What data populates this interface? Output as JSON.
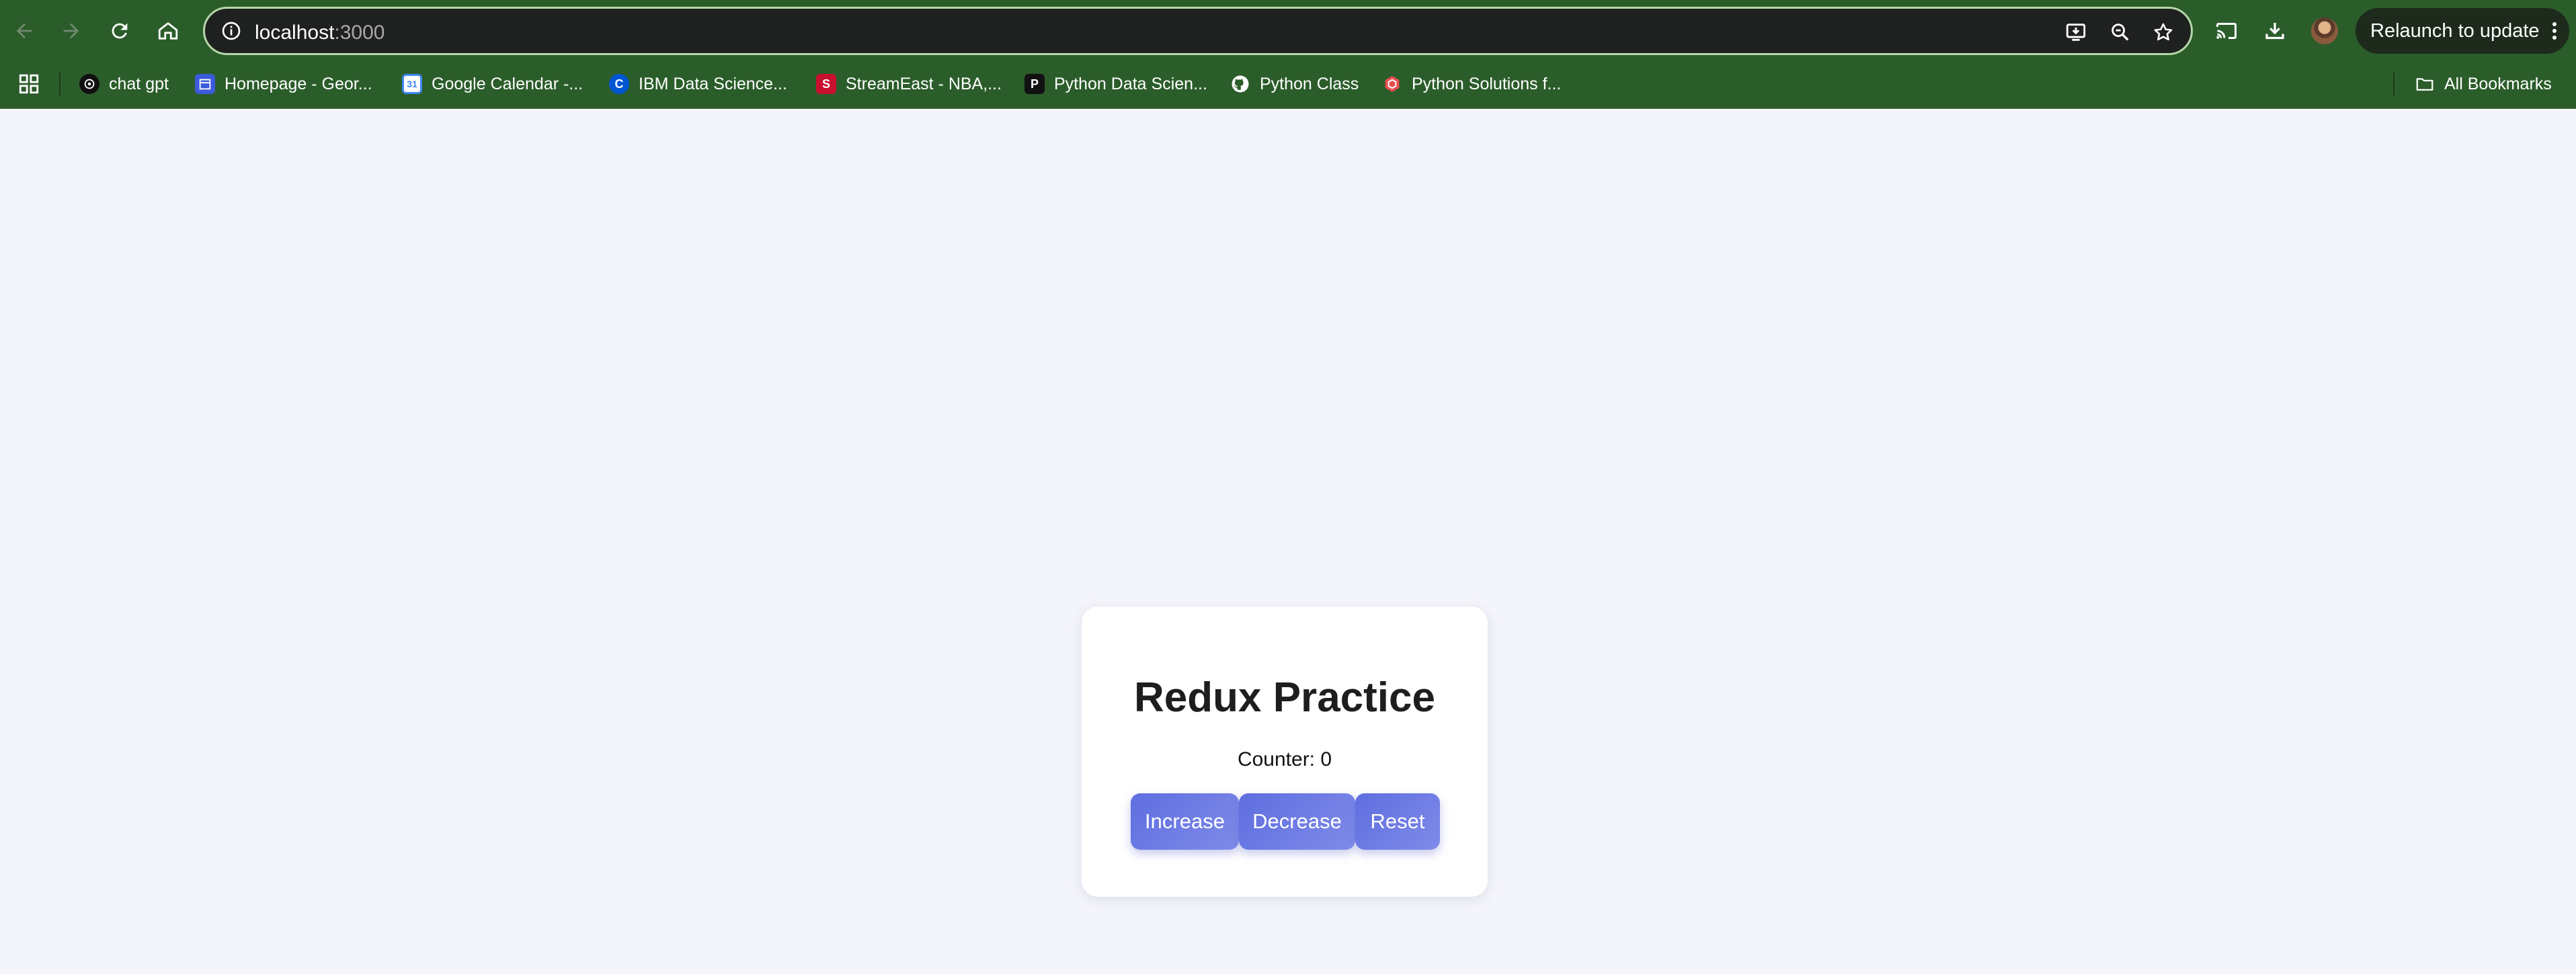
{
  "browser": {
    "url_host": "localhost",
    "url_port": ":3000",
    "relaunch_label": "Relaunch to update",
    "accent_color": "#2b5d2a"
  },
  "toolbar_icons": [
    "back-icon",
    "forward-icon",
    "reload-icon",
    "home-icon",
    "site-info-icon",
    "install-app-icon",
    "zoom-icon",
    "bookmark-star-icon",
    "cast-icon",
    "download-icon",
    "profile-avatar",
    "menu-kebab-icon"
  ],
  "bookmarks": {
    "items": [
      {
        "label": "chat gpt",
        "icon": "openai-icon"
      },
      {
        "label": "Homepage - Geor...",
        "icon": "calendar-blue-icon"
      },
      {
        "label": "Google Calendar -...",
        "icon": "google-calendar-icon"
      },
      {
        "label": "IBM Data Science...",
        "icon": "coursera-icon"
      },
      {
        "label": "StreamEast - NBA,...",
        "icon": "streameast-icon"
      },
      {
        "label": "Python Data Scien...",
        "icon": "p-icon"
      },
      {
        "label": "Python Class",
        "icon": "github-icon"
      },
      {
        "label": "Python Solutions f...",
        "icon": "hexagon-icon"
      }
    ],
    "all_bookmarks_label": "All Bookmarks"
  },
  "page": {
    "title": "Redux Practice",
    "counter_label": "Counter: 0",
    "buttons": {
      "increase": "Increase",
      "decrease": "Decrease",
      "reset": "Reset"
    },
    "button_color": "#6674e4"
  }
}
